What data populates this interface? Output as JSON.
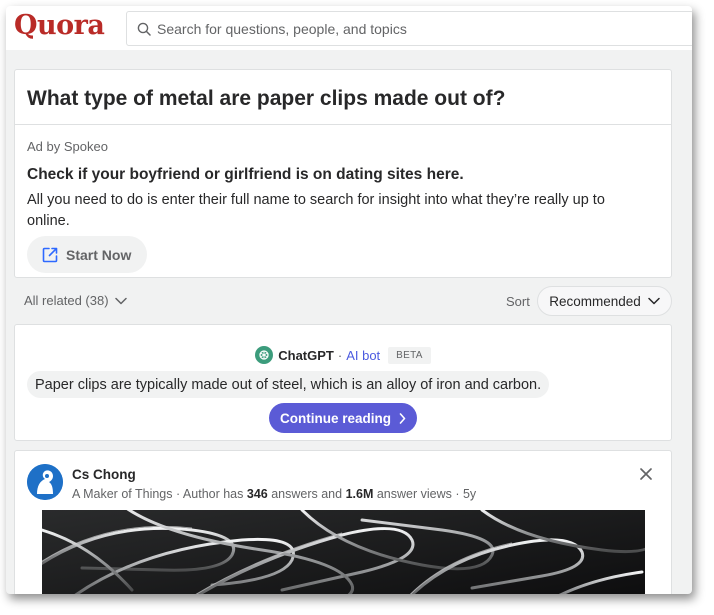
{
  "header": {
    "logo": "Quora",
    "search_placeholder": "Search for questions, people, and topics"
  },
  "question": {
    "title": "What type of metal are paper clips made out of?"
  },
  "ad": {
    "label": "Ad by Spokeo",
    "headline": "Check if your boyfriend or girlfriend is on dating sites here.",
    "body": "All you need to do is enter their full name to search for insight into what they’re really up to online.",
    "cta": "Start Now"
  },
  "related": {
    "label": "All related (38)",
    "sort_label": "Sort",
    "sort_value": "Recommended"
  },
  "chatgpt": {
    "name": "ChatGPT",
    "separator": "·",
    "tag": "AI bot",
    "badge": "BETA",
    "text": "Paper clips are typically made out of steel, which is an alloy of iron and carbon.",
    "cta": "Continue reading"
  },
  "answer": {
    "author": "Cs Chong",
    "cred_prefix": "A Maker of Things · Author has ",
    "answers_count": "346",
    "cred_mid": " answers and ",
    "views_count": "1.6M",
    "cred_suffix": " answer views · 5y"
  },
  "colors": {
    "brand": "#b92b27",
    "accent": "#5b5bd6",
    "bot_link": "#4c5be0"
  }
}
